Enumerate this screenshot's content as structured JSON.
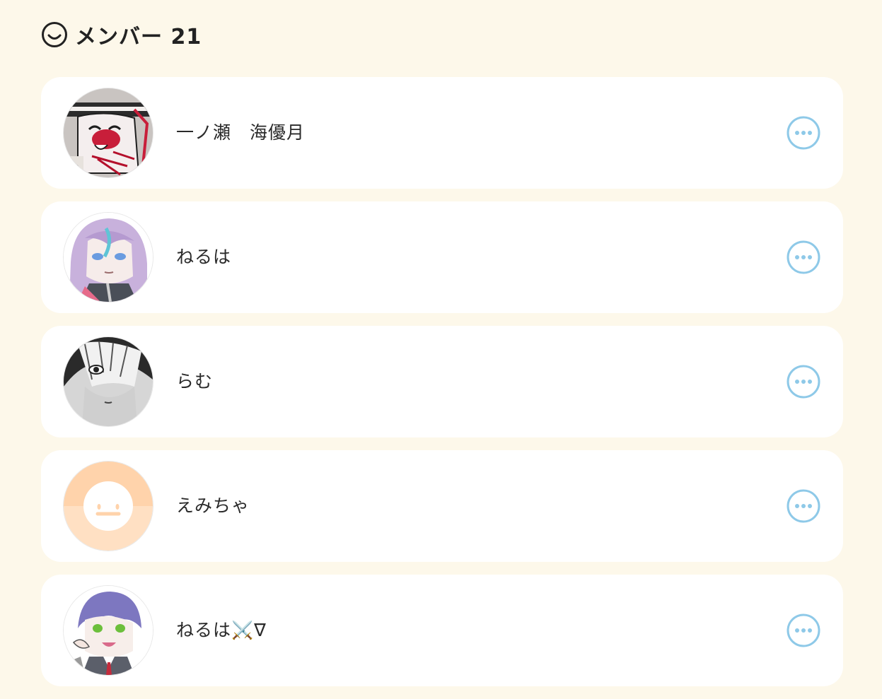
{
  "header": {
    "title": "メンバー 21"
  },
  "colors": {
    "background": "#fdf8ea",
    "card": "#ffffff",
    "more_icon": "#8ec9e8",
    "default_avatar": "#ffd8b0"
  },
  "members": [
    {
      "name": "一ノ瀬　海優月",
      "avatar": "drawn-red-character-avatar",
      "more_icon": "more-options-icon"
    },
    {
      "name": "ねるは",
      "avatar": "purple-hair-anime-avatar",
      "more_icon": "more-options-icon"
    },
    {
      "name": "らむ",
      "avatar": "monochrome-manga-avatar",
      "more_icon": "more-options-icon"
    },
    {
      "name": "えみちゃ",
      "avatar": "default-smile-avatar",
      "more_icon": "more-options-icon"
    },
    {
      "name": "ねるは⚔️∇",
      "avatar": "purple-hair-boy-avatar",
      "more_icon": "more-options-icon"
    }
  ]
}
